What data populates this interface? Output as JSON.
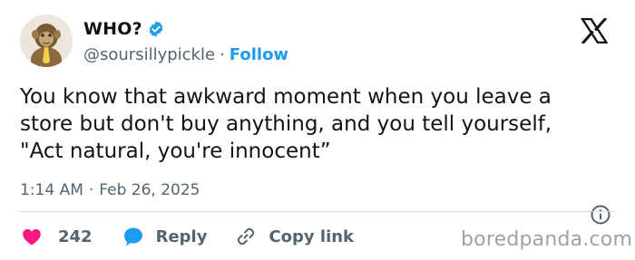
{
  "author": {
    "display_name": "WHO?",
    "handle": "@soursillypickle",
    "separator": "·",
    "follow_label": "Follow",
    "verified": true
  },
  "icons": {
    "verified": "verified-badge-icon",
    "platform": "x-logo-icon",
    "info": "info-icon",
    "like": "heart-icon",
    "reply": "speech-bubble-icon",
    "copy": "link-icon"
  },
  "tweet": {
    "text": "You know that awkward moment when you leave a\nstore but don't buy anything, and you tell yourself,\n\"Act natural, you're innocent”"
  },
  "meta": {
    "time": "1:14 AM",
    "separator": "·",
    "date": "Feb 26, 2025"
  },
  "actions": {
    "like_count": "242",
    "reply_label": "Reply",
    "copy_label": "Copy link"
  },
  "watermark": "boredpanda.com",
  "colors": {
    "accent": "#1d9bf0",
    "like": "#f91880",
    "text": "#0f1419",
    "secondary": "#536471",
    "divider": "#cfd9de"
  }
}
